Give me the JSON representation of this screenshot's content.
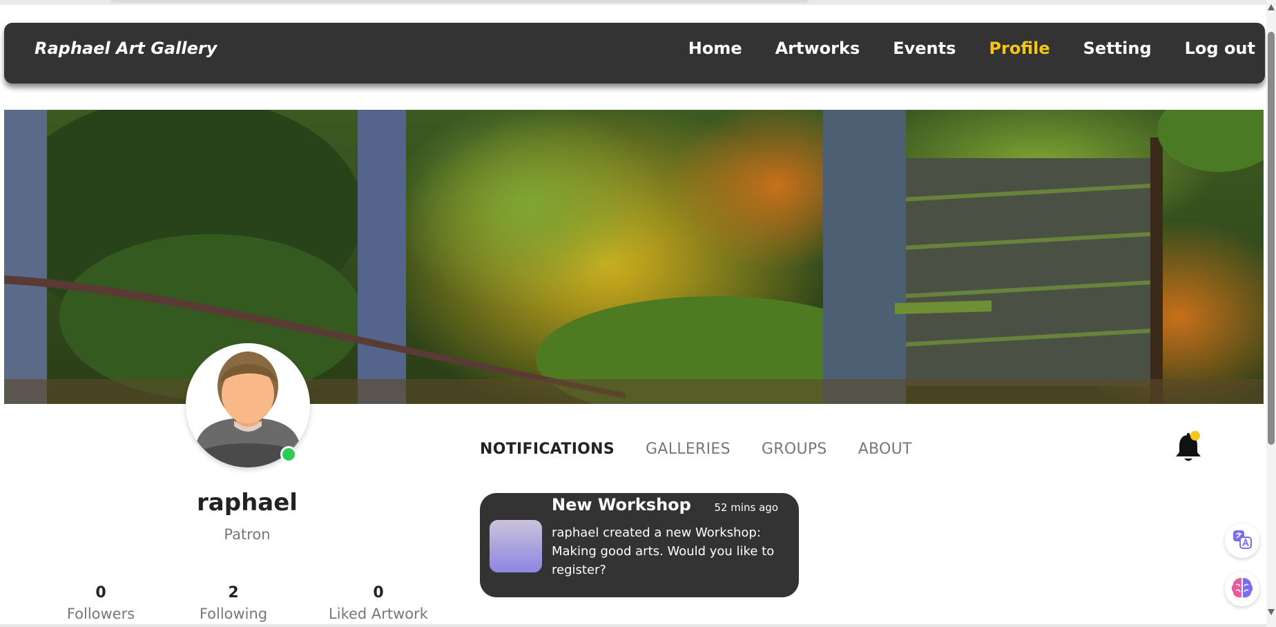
{
  "nav": {
    "brand": "Raphael Art Gallery",
    "items": [
      {
        "label": "Home",
        "active": false
      },
      {
        "label": "Artworks",
        "active": false
      },
      {
        "label": "Events",
        "active": false
      },
      {
        "label": "Profile",
        "active": true
      },
      {
        "label": "Setting",
        "active": false
      },
      {
        "label": "Log out",
        "active": false
      }
    ]
  },
  "colors": {
    "navbar_bg": "#333333",
    "accent": "#f5c518",
    "online": "#2ecc55",
    "card_bg": "#333333"
  },
  "profile": {
    "username": "raphael",
    "role": "Patron",
    "online": true,
    "stats": [
      {
        "value": "0",
        "label": "Followers"
      },
      {
        "value": "2",
        "label": "Following"
      },
      {
        "value": "0",
        "label": "Liked Artwork"
      }
    ]
  },
  "tabs": [
    {
      "label": "NOTIFICATIONS",
      "active": true
    },
    {
      "label": "GALLERIES",
      "active": false
    },
    {
      "label": "GROUPS",
      "active": false
    },
    {
      "label": "ABOUT",
      "active": false
    }
  ],
  "notifications": [
    {
      "title": "New Workshop",
      "time": "52 mins ago",
      "body": "raphael created a new Workshop: Making good arts. Would you like to register?"
    }
  ],
  "icons": {
    "bell": "bell-icon",
    "translate": "translate-icon",
    "brain": "brain-icon"
  }
}
